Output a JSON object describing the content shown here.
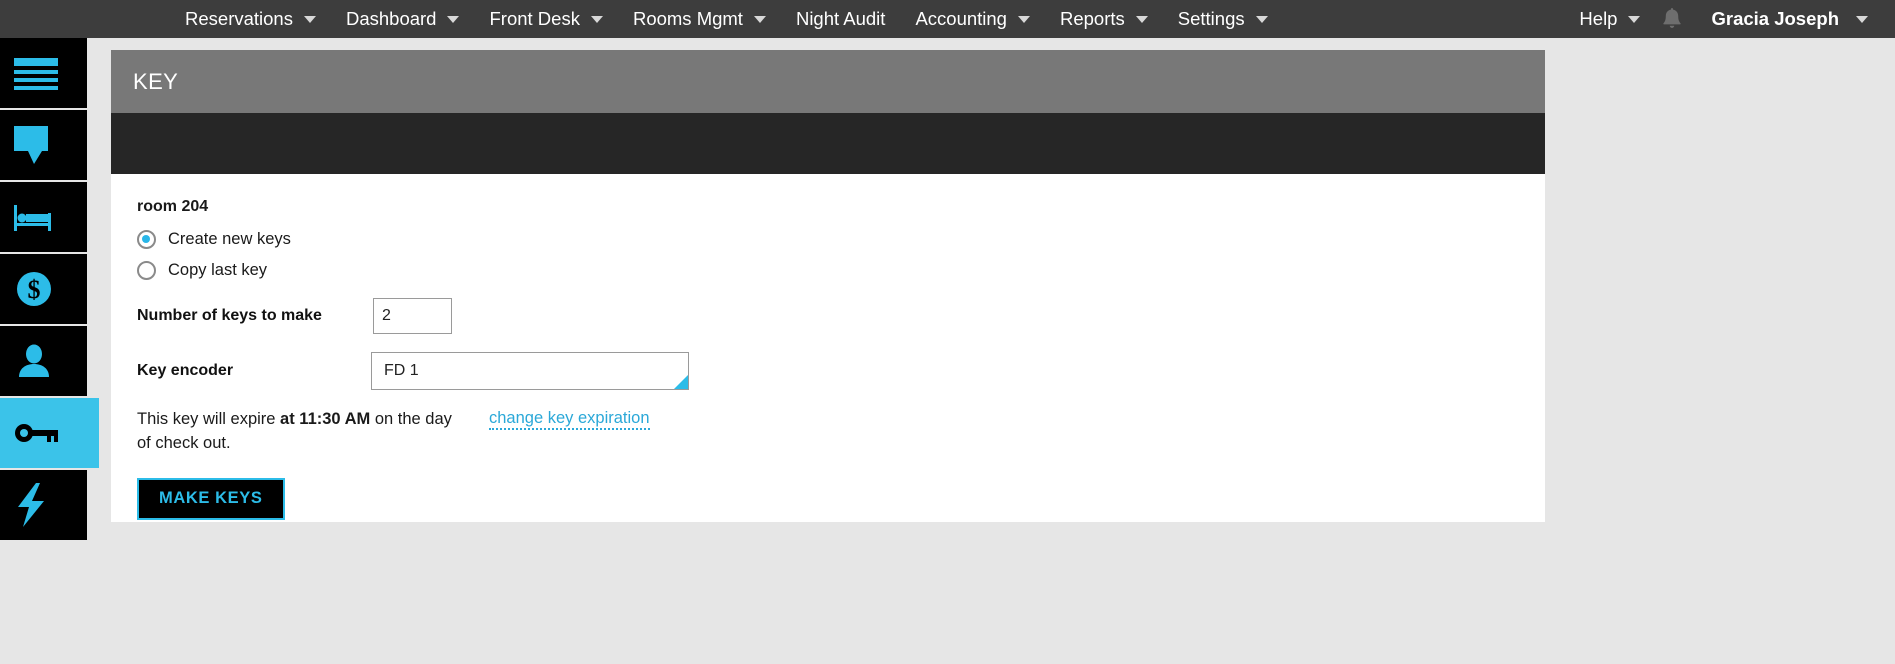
{
  "topnav": {
    "items": [
      {
        "label": "Reservations",
        "caret": true
      },
      {
        "label": "Dashboard",
        "caret": true
      },
      {
        "label": "Front Desk",
        "caret": true
      },
      {
        "label": "Rooms Mgmt",
        "caret": true
      },
      {
        "label": "Night Audit",
        "caret": false
      },
      {
        "label": "Accounting",
        "caret": true
      },
      {
        "label": "Reports",
        "caret": true
      },
      {
        "label": "Settings",
        "caret": true
      },
      {
        "label": "Help",
        "caret": true
      }
    ],
    "notification_icon": "bell-icon",
    "user": "Gracia Joseph",
    "background": "#3d3d3d"
  },
  "sidebar": {
    "items": [
      {
        "icon": "hamburger-menu-icon",
        "active": false
      },
      {
        "icon": "chat-bubble-icon",
        "active": false
      },
      {
        "icon": "bed-icon",
        "active": false
      },
      {
        "icon": "dollar-coin-icon",
        "active": false
      },
      {
        "icon": "person-icon",
        "active": false
      },
      {
        "icon": "key-icon",
        "active": true
      },
      {
        "icon": "lightning-bolt-icon",
        "active": false
      }
    ],
    "active_color": "#3bc3e9",
    "icon_color": "#2cbce8"
  },
  "panel": {
    "title": "KEY",
    "room_title": "room 204",
    "radios": [
      {
        "label": "Create new keys",
        "checked": true
      },
      {
        "label": "Copy last key",
        "checked": false
      }
    ],
    "number_field": {
      "label": "Number of keys to make",
      "value": "2"
    },
    "encoder_field": {
      "label": "Key encoder",
      "value": "FD 1"
    },
    "expiration": {
      "text_before": "This key will expire ",
      "time": "at 11:30 AM",
      "text_after": " on the day of check out.",
      "link": "change key expiration",
      "link_color": "#2ba8d8"
    },
    "make_keys_button": "MAKE KEYS",
    "accent": "#2cbce8"
  }
}
